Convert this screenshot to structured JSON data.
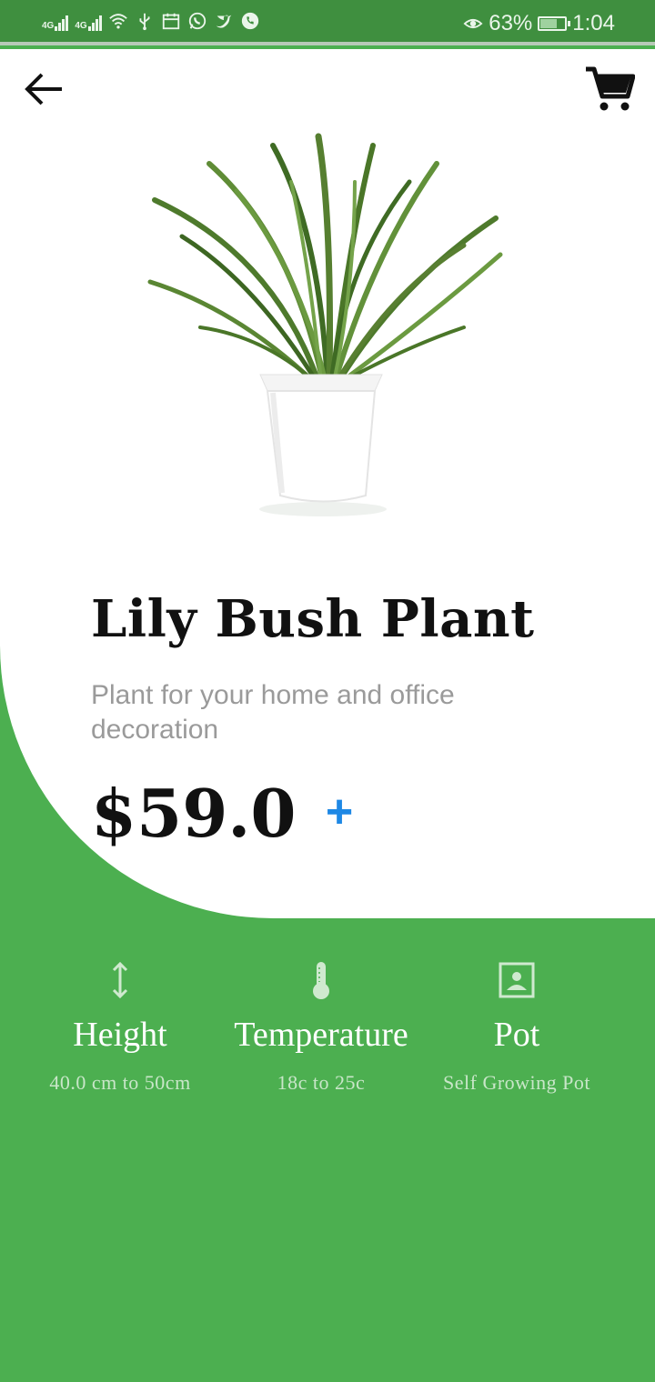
{
  "status_bar": {
    "signal_1": "4G",
    "signal_2": "4G",
    "battery_percent": "63%",
    "time": "1:04",
    "battery_level": 0.63
  },
  "header": {
    "back_icon": "arrow-left-icon",
    "cart_icon": "shopping-cart-icon"
  },
  "product": {
    "title": "Lily Bush Plant",
    "description": "Plant for your home and office decoration",
    "price": "$59.0",
    "add_icon": "plus-icon"
  },
  "specs": [
    {
      "icon": "height-arrows-icon",
      "label": "Height",
      "value": "40.0 cm to 50cm"
    },
    {
      "icon": "thermometer-icon",
      "label": "Temperature",
      "value": "18c to 25c"
    },
    {
      "icon": "portrait-frame-icon",
      "label": "Pot",
      "value": "Self Growing Pot"
    }
  ],
  "colors": {
    "accent_green": "#4caf50",
    "status_green": "#3f8f3f",
    "add_blue": "#1e88e5",
    "spec_value": "#c9e6c9"
  }
}
